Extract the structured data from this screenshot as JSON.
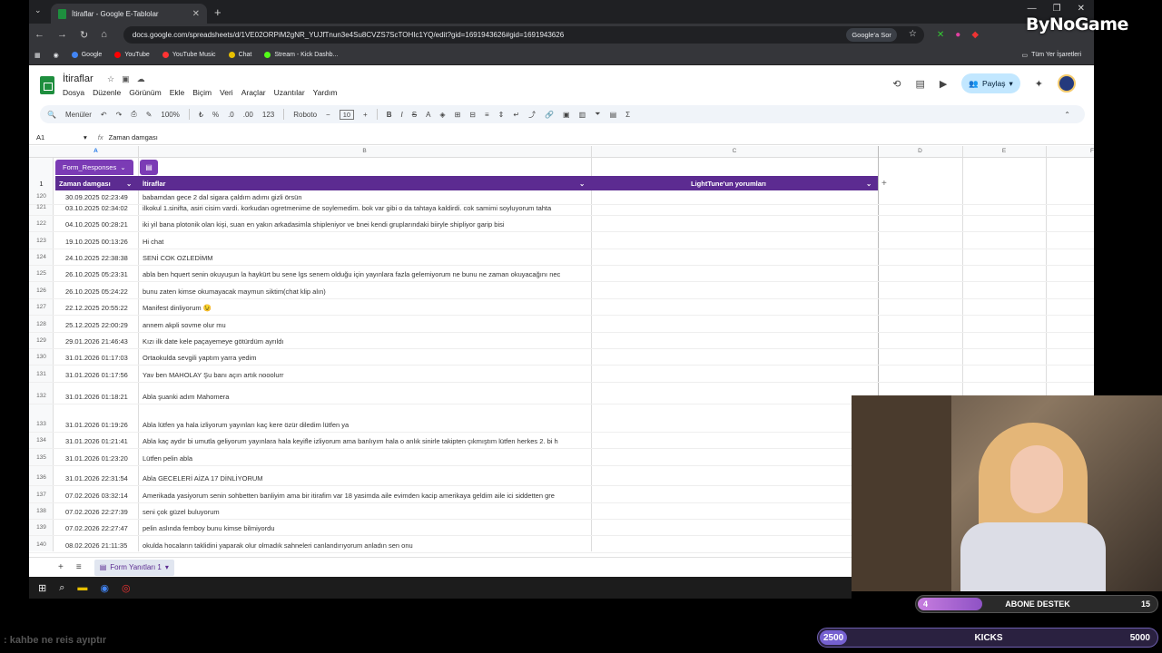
{
  "browser": {
    "tab_title": "İtiraflar - Google E-Tablolar",
    "url": "docs.google.com/spreadsheets/d/1VE02ORPiM2gNR_YUJfTnun3e4Su8CVZS7ScTOHIc1YQ/edit?gid=1691943626#gid=1691943626",
    "lens_label": "Google'a Sor",
    "bookmarks": [
      "Google",
      "YouTube",
      "YouTube Music",
      "Chat",
      "Stream - Kick Dashb..."
    ],
    "bookmarks_right": "Tüm Yer İşaretleri"
  },
  "sheets": {
    "title": "İtiraflar",
    "menus": [
      "Dosya",
      "Düzenle",
      "Görünüm",
      "Ekle",
      "Biçim",
      "Veri",
      "Araçlar",
      "Uzantılar",
      "Yardım"
    ],
    "share_label": "Paylaş",
    "menus_button": "Menüler",
    "zoom": "100%",
    "font": "Roboto",
    "font_size": "10",
    "cell_ref": "A1",
    "formula": "Zaman damgası",
    "columns": [
      "A",
      "B",
      "C",
      "D",
      "E",
      "F"
    ],
    "table_name": "Form_Responses",
    "headers": [
      "Zaman damgası",
      "İtiraflar",
      "LightTune'un yorumları"
    ],
    "sheet_tab": "Form Yanıtları 1"
  },
  "rows": [
    {
      "n": "120",
      "ts": "30.09.2025 02:23:49",
      "tx": "babamdan gece 2 dal sigara çaldım adımı gizli örsün"
    },
    {
      "n": "121",
      "ts": "03.10.2025 02:34:02",
      "tx": "ilkokul 1.sinifta, asiri cisim vardi. korkudan ogretmenime de soylemedim. bok var gibi o da tahtaya kaldirdi. cok samimi soyluyorum tahta"
    },
    {
      "n": "122",
      "ts": "04.10.2025 00:28:21",
      "tx": "iki yil bana plotonik olan kişi, suan en yakın arkadasimla shipleniyor ve bnei kendi gruplarındaki biiryle shipliyor garip bisi"
    },
    {
      "n": "123",
      "ts": "19.10.2025 00:13:26",
      "tx": "Hi chat"
    },
    {
      "n": "124",
      "ts": "24.10.2025 22:38:38",
      "tx": "SENİ COK OZLEDİMM"
    },
    {
      "n": "125",
      "ts": "26.10.2025 05:23:31",
      "tx": "abla ben hquert senin okuyuşun la haykürt bu sene lgs senem olduğu için yayınlara fazla gelemiyorum ne bunu ne zaman okuyacağını nec"
    },
    {
      "n": "126",
      "ts": "26.10.2025 05:24:22",
      "tx": "bunu zaten kimse okumayacak maymun siktim(chat klip alın)"
    },
    {
      "n": "127",
      "ts": "22.12.2025 20:55:22",
      "tx": "Manifest dinliyorum 😉"
    },
    {
      "n": "128",
      "ts": "25.12.2025 22:00:29",
      "tx": "annem akpli sovme olur mu"
    },
    {
      "n": "129",
      "ts": "29.01.2026 21:46:43",
      "tx": "Kızı ilk date kele paçayemeye götürdüm ayrıldı"
    },
    {
      "n": "130",
      "ts": "31.01.2026 01:17:03",
      "tx": "Ortaokulda sevgili yaptım yarra yedim"
    },
    {
      "n": "131",
      "ts": "31.01.2026 01:17:56",
      "tx": "Yav ben MAHOLAY Şu banı açın artık nooolurr"
    },
    {
      "n": "132",
      "ts": "31.01.2026 01:18:21",
      "tx": "Abla şuanki adım Mahomera"
    },
    {
      "n": "133",
      "ts": "31.01.2026 01:19:26",
      "tx": "Abla lütfen ya hala izliyorum yayınları kaç kere özür diledim lütfen ya"
    },
    {
      "n": "134",
      "ts": "31.01.2026 01:21:41",
      "tx": "Abla kaç aydır bi umutla geliyorum yayınlara hala keyifle izliyorum ama banlıyım hala o anlık sinirle takipten çıkmıştım lütfen herkes 2. bi h"
    },
    {
      "n": "135",
      "ts": "31.01.2026 01:23:20",
      "tx": "Lütfen pelin abla"
    },
    {
      "n": "136",
      "ts": "31.01.2026 22:31:54",
      "tx": "Abla GECELERİ AİZA 17 DİNLİYORUM"
    },
    {
      "n": "137",
      "ts": "07.02.2026 03:32:14",
      "tx": "Amerikada yasiyorum senin sohbetten banliyim ama bir itirafim var 18 yasimda aile evimden kacip amerikaya geldim aile ici siddetten gre"
    },
    {
      "n": "138",
      "ts": "07.02.2026 22:27:39",
      "tx": "seni çok güzel buluyorum"
    },
    {
      "n": "139",
      "ts": "07.02.2026 22:27:47",
      "tx": "pelin aslında femboy bunu kimse bilmiyordu"
    },
    {
      "n": "140",
      "ts": "08.02.2026 21:11:35",
      "tx": "okulda hocaların taklidini yaparak olur olmadık sahneleri canlandırıyorum anladın sen onu"
    }
  ],
  "overlay": {
    "brand": "ByNoGame",
    "sub_label": "ABONE DESTEK",
    "sub_left": "4",
    "sub_right": "15",
    "sub_progress": 0.27,
    "kicks_label": "KICKS",
    "kicks_left": "2500",
    "kicks_right": "5000",
    "chat_line": ": kahbe ne reis ayıptır"
  }
}
